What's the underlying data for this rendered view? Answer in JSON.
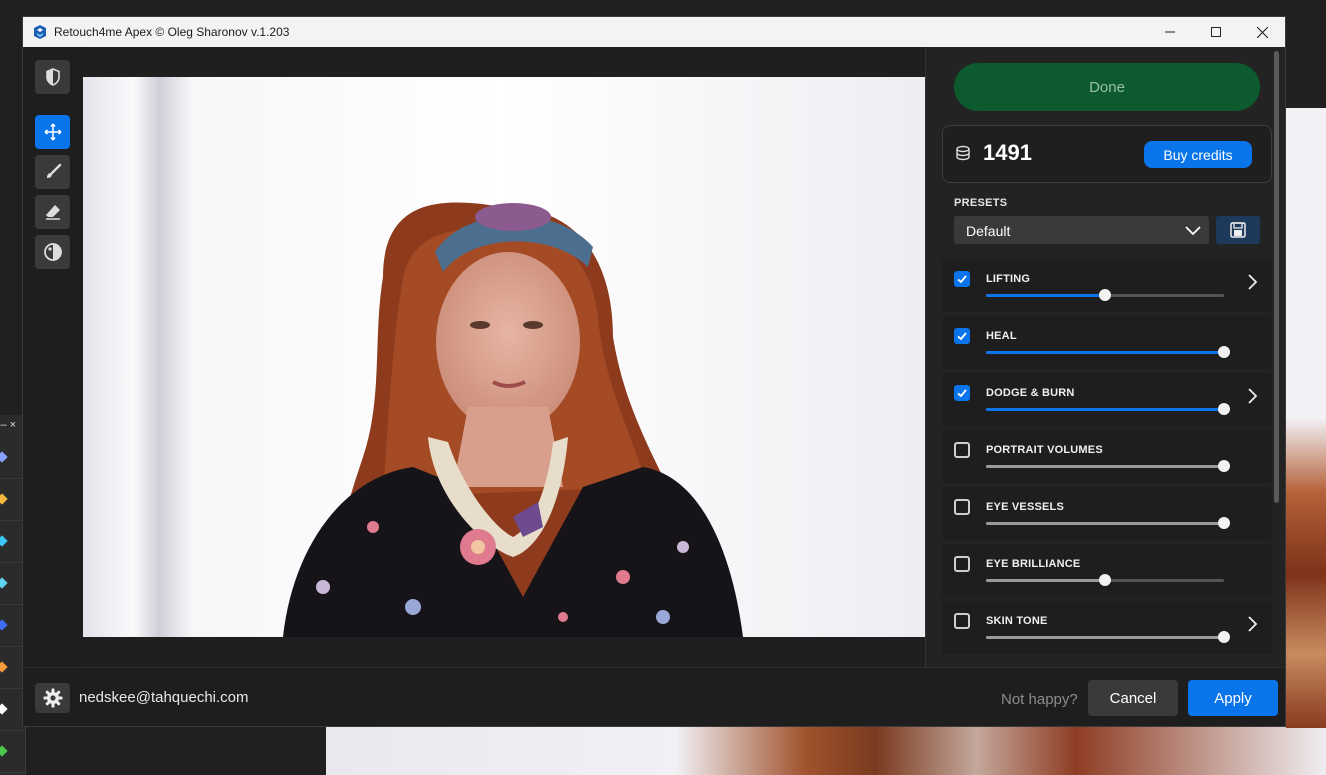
{
  "window": {
    "title": "Retouch4me Apex © Oleg Sharonov v.1.203"
  },
  "left_toolbar": {
    "tools": [
      "logo-icon",
      "move-icon",
      "brush-icon",
      "eraser-icon",
      "contrast-icon"
    ],
    "active_tool": "move-icon"
  },
  "right_panel": {
    "done_label": "Done",
    "credits": "1491",
    "buy_label": "Buy credits",
    "presets_label": "PRESETS",
    "preset_value": "Default",
    "adjustments": [
      {
        "label": "LIFTING",
        "checked": true,
        "value": 0.5,
        "has_arrow": true
      },
      {
        "label": "HEAL",
        "checked": true,
        "value": 1.0,
        "has_arrow": false
      },
      {
        "label": "DODGE & BURN",
        "checked": true,
        "value": 1.0,
        "has_arrow": true
      },
      {
        "label": "PORTRAIT VOLUMES",
        "checked": false,
        "value": 1.0,
        "has_arrow": false
      },
      {
        "label": "EYE VESSELS",
        "checked": false,
        "value": 1.0,
        "has_arrow": false
      },
      {
        "label": "EYE BRILLIANCE",
        "checked": false,
        "value": 0.5,
        "has_arrow": false
      },
      {
        "label": "SKIN TONE",
        "checked": false,
        "value": 1.0,
        "has_arrow": true
      }
    ]
  },
  "bottom_bar": {
    "email": "nedskee@tahquechi.com",
    "not_happy": "Not happy?",
    "cancel_label": "Cancel",
    "apply_label": "Apply"
  },
  "colors": {
    "accent": "#0a74ea",
    "done_bg": "#0c5a2e",
    "panel_bg": "#232323"
  }
}
